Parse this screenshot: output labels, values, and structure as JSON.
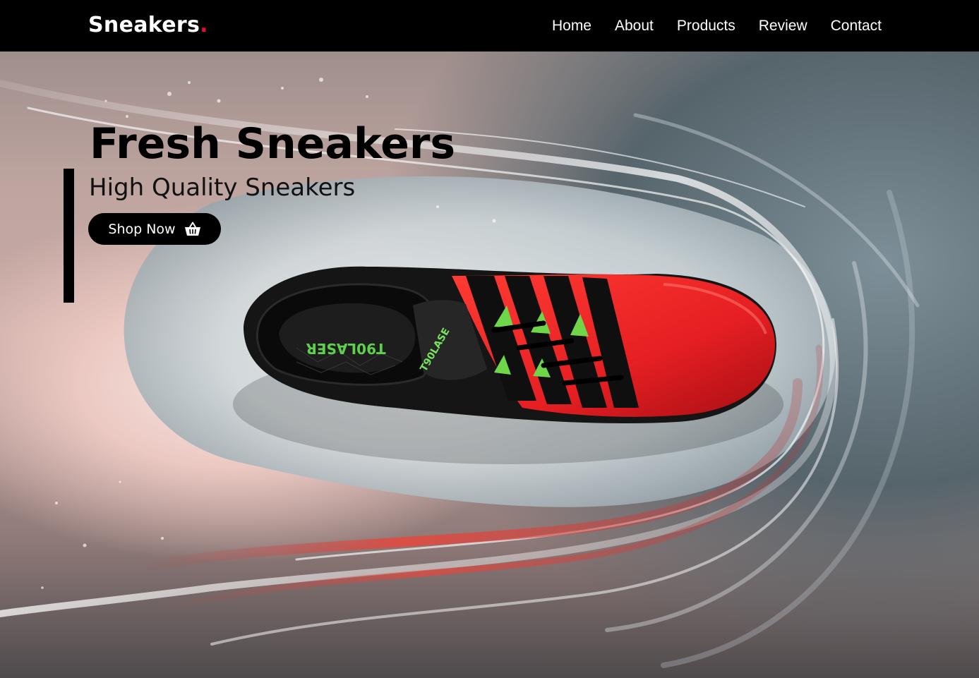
{
  "brand": {
    "name": "Sneakers",
    "dot": "."
  },
  "nav": {
    "items": [
      {
        "label": "Home"
      },
      {
        "label": "About"
      },
      {
        "label": "Products"
      },
      {
        "label": "Review"
      },
      {
        "label": "Contact"
      }
    ]
  },
  "hero": {
    "title": "Fresh Sneakers",
    "subtitle": "High Quality Sneakers",
    "cta_label": "Shop Now",
    "cta_icon": "shopping-basket-icon",
    "image": {
      "subject": "shoe-splash-image",
      "shoe_print_lateral": "T90LASER",
      "shoe_print_tongue": "T90LASE"
    }
  },
  "colors": {
    "nav_bg": "#000000",
    "brand_dot": "#e0102a",
    "cta_bg": "#000000",
    "shoe_red": "#e51f22",
    "shoe_accent_green": "#6fd64a"
  }
}
